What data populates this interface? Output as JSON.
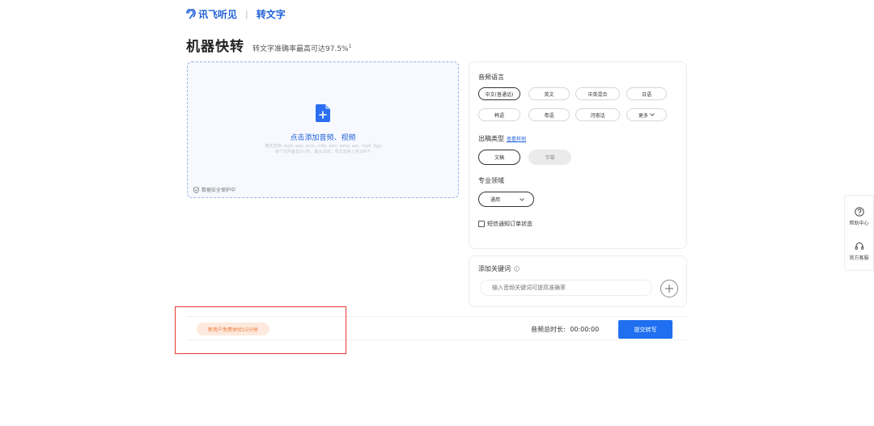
{
  "header": {
    "logo_text": "讯飞听见",
    "separator": "|",
    "product": "转文字"
  },
  "title": {
    "main": "机器快转",
    "subtitle": "转文字准确率最高可达97.5%",
    "superscript": "1"
  },
  "upload": {
    "action_text": "点击添加音频、视频",
    "hint_line1": "格式支持: mp3, wav, pcm, m4a, amr, wma, aac, mp4, 3gp",
    "hint_line2": "单个文件最长5小时，最大2GB，单次支持上传100个",
    "secure_text": "数据安全保护中",
    "icon_color": "#2b6ef2"
  },
  "options": {
    "language_label": "音频语言",
    "languages": [
      "中文(普通话)",
      "英文",
      "中英混合",
      "日语",
      "韩语",
      "粤语",
      "河南话",
      "更多"
    ],
    "output_label": "出稿类型",
    "output_link": "查看样例",
    "outputs": [
      "文稿",
      "字幕"
    ],
    "domain_label": "专业领域",
    "domain_value": "通用",
    "sms_label": "短信通知订单状态"
  },
  "keywords": {
    "label": "添加关键词",
    "placeholder": "输入音频关键词可提高准确率"
  },
  "footer": {
    "promo": "新用户免费体验15分钟",
    "duration_label": "音频总时长:",
    "duration_value": "00:00:00",
    "submit": "提交转写"
  },
  "side": {
    "help": "帮助中心",
    "service": "官方客服"
  },
  "colors": {
    "brand": "#1f5fd8",
    "primary_button": "#1f6ff0",
    "promo_bg": "#fde9dd",
    "promo_text": "#f07c3c",
    "annotation": "#e53935"
  }
}
